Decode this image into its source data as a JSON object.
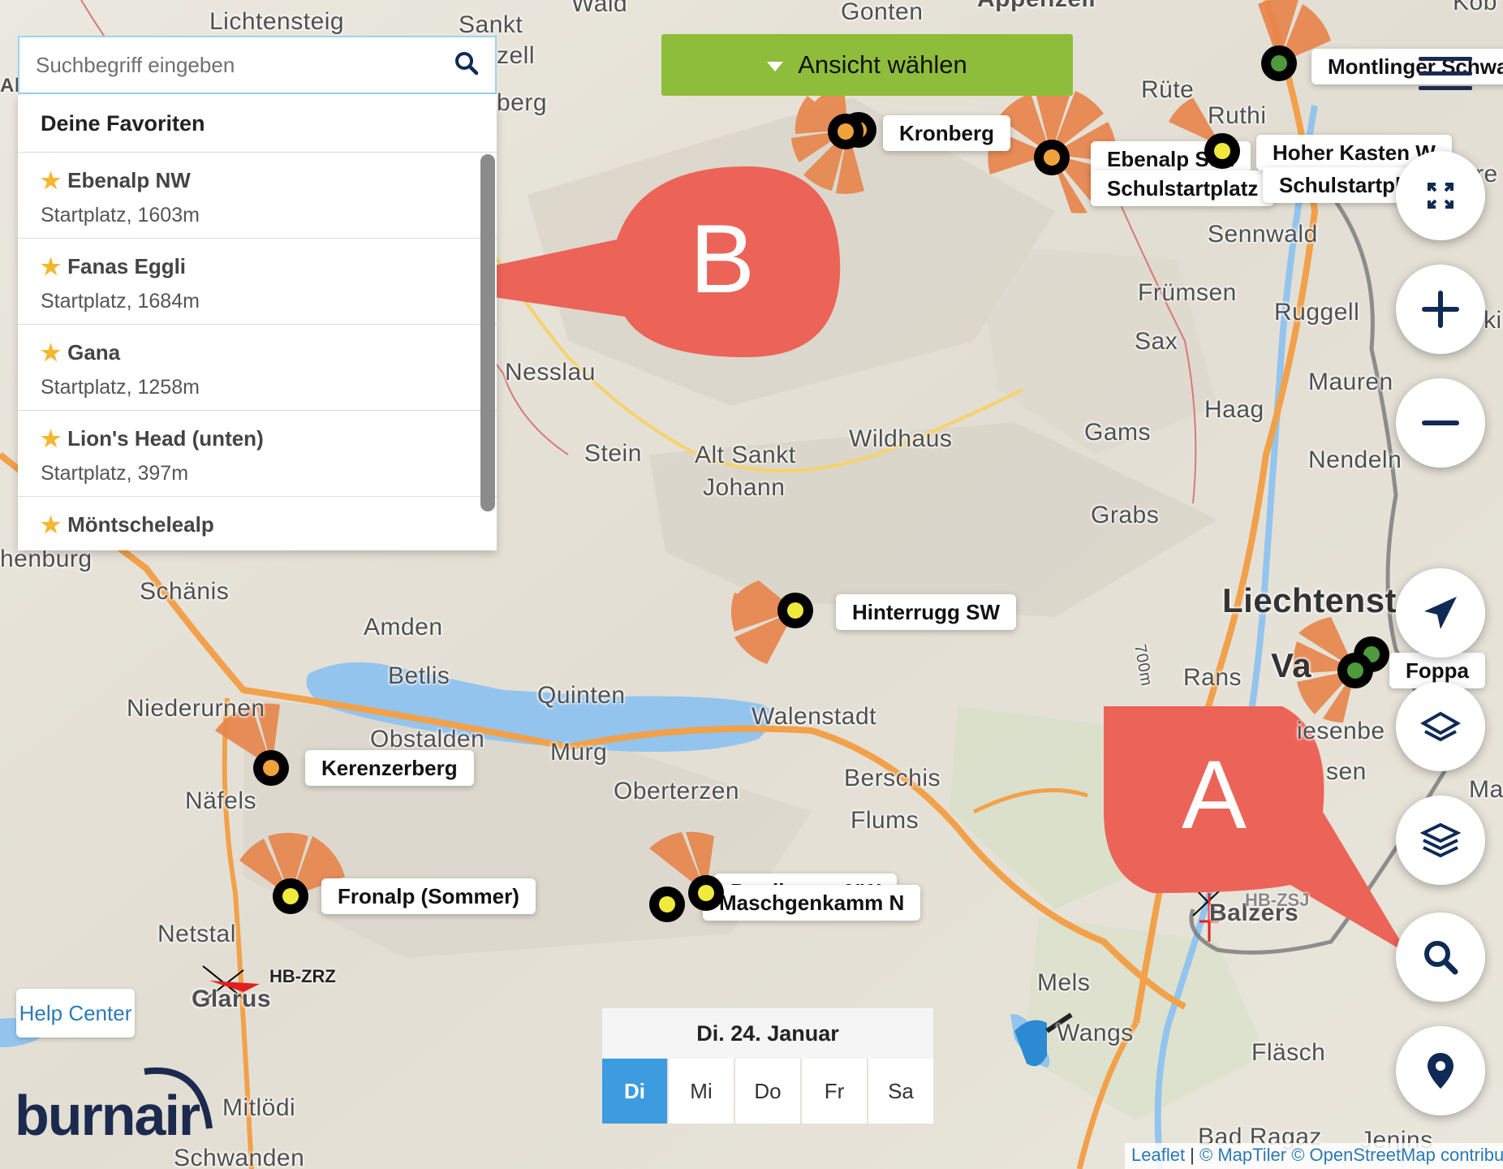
{
  "search": {
    "placeholder": "Suchbegriff eingeben"
  },
  "favorites": {
    "header": "Deine Favoriten",
    "items": [
      {
        "name": "Ebenalp NW",
        "sub": "Startplatz, 1603m"
      },
      {
        "name": "Fanas Eggli",
        "sub": "Startplatz, 1684m"
      },
      {
        "name": "Gana",
        "sub": "Startplatz, 1258m"
      },
      {
        "name": "Lion's Head (unten)",
        "sub": "Startplatz, 397m"
      },
      {
        "name": "Möntschelealp",
        "sub": ""
      }
    ]
  },
  "view_selector": {
    "label": "Ansicht wählen"
  },
  "map": {
    "places": [
      "Lichtensteig",
      "Sankt",
      "zell",
      "berg",
      "Wald",
      "Gonten",
      "Appenzell",
      "Rüte",
      "Ruthi",
      "Sennwald",
      "Frümsen",
      "Sax",
      "Ruggell",
      "Mauren",
      "Haag",
      "Gams",
      "Nendeln",
      "Nesslau",
      "Stein",
      "Alt Sankt",
      "Johann",
      "Wildhaus",
      "Grabs",
      "Liechtenst",
      "Va",
      "Rans",
      "iesenbe",
      "sen",
      "Ma",
      "henburg",
      "Schänis",
      "Amden",
      "Betlis",
      "Quinten",
      "Niederurnen",
      "Obstalden",
      "Murg",
      "Walenstadt",
      "Näfels",
      "Oberterzen",
      "Berschis",
      "Flums",
      "Netstal",
      "Glarus",
      "Balzers",
      "Mels",
      "Wangs",
      "Fläsch",
      "Mitlödi",
      "Schwanden",
      "Bad Ragaz",
      "Jenins",
      "Al",
      "Kob",
      "re",
      "ki"
    ],
    "sites": [
      "Montlinger Schwamm",
      "Kronberg",
      "Ebenalp Süd",
      "Schulstartplatz",
      "Hoher Kasten W",
      "Schulstartplatz",
      "Hinterrugg SW",
      "Foppa",
      "Kerenzerberg",
      "Fronalp (Sommer)",
      "Maschgenkamm N",
      "Prodkamm NW"
    ],
    "aircraft": [
      "HB-ZRZ",
      "HB-ZSJ"
    ],
    "contour": "700m"
  },
  "controls": {
    "fullscreen": "expand-icon",
    "zoom_in": "plus-icon",
    "zoom_out": "minus-icon",
    "send": "paper-plane-icon",
    "layer1": "layer-single-icon",
    "layers": "layers-icon",
    "search": "search-icon",
    "locate": "location-pin-icon"
  },
  "date": {
    "title": "Di. 24. Januar",
    "tabs": [
      "Di",
      "Mi",
      "Do",
      "Fr",
      "Sa"
    ],
    "active": "Di"
  },
  "help": {
    "label": "Help Center"
  },
  "logo": {
    "text": "burnair"
  },
  "attribution": {
    "leaflet": "Leaflet",
    "sep": " | ",
    "maptiler": "© MapTiler",
    "osm": "© OpenStreetMap contributors"
  },
  "callouts": {
    "a": "A",
    "b": "B"
  },
  "colors": {
    "accent_green": "#8ebd3b",
    "callout_red": "#ec6457",
    "active_day": "#3d9be0",
    "lake": "#93c4ee",
    "road": "#f2a14a"
  }
}
